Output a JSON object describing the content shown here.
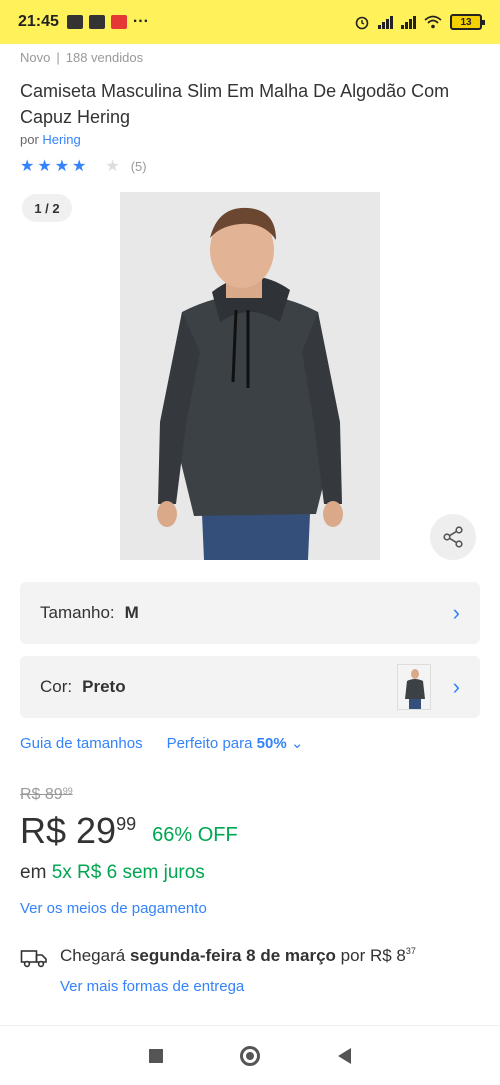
{
  "status_bar": {
    "time": "21:45",
    "battery": "13"
  },
  "product": {
    "condition": "Novo",
    "sold": "188 vendidos",
    "title": "Camiseta Masculina Slim Em Malha De Algodão Com Capuz Hering",
    "brand_prefix": "por",
    "brand": "Hering",
    "rating": 4,
    "reviews": "(5)",
    "image_counter": "1 / 2"
  },
  "size_selector": {
    "label": "Tamanho:",
    "value": "M"
  },
  "color_selector": {
    "label": "Cor:",
    "value": "Preto"
  },
  "links": {
    "size_guide": "Guia de tamanhos",
    "fit_prefix": "Perfeito para",
    "fit_value": "50%"
  },
  "pricing": {
    "old_price": "R$ 89",
    "old_cents": "99",
    "price": "R$ 29",
    "price_cents": "99",
    "discount": "66% OFF",
    "installments_prefix": "em",
    "installments": "5x R$ 6 sem juros",
    "payment_link": "Ver os meios de pagamento"
  },
  "shipping": {
    "prefix": "Chegará",
    "date": "segunda-feira 8 de março",
    "by": "por R$ 8",
    "cents": "37",
    "more_link": "Ver mais formas de entrega"
  },
  "colors": {
    "status_bar": "#fff159",
    "link": "#3483fa",
    "green": "#00a650"
  }
}
